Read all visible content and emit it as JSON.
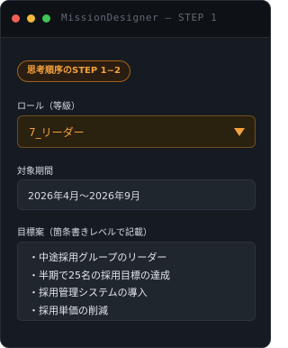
{
  "window": {
    "title": "MissionDesigner — STEP 1"
  },
  "badge": {
    "label": "思考順序のSTEP 1~2"
  },
  "role_field": {
    "label": "ロール（等級）",
    "selected": "7_リーダー"
  },
  "period_field": {
    "label": "対象期間",
    "value": "2026年4月〜2026年9月"
  },
  "goals_field": {
    "label": "目標案（箇条書きレベルで記載）",
    "items": [
      "・中途採用グループのリーダー",
      "・半期で25名の採用目標の達成",
      "・採用管理システムの導入",
      "・採用単価の削減"
    ]
  },
  "colors": {
    "background": "#161b22",
    "titlebar": "#0e1217",
    "accent": "#f3a13b",
    "close": "#ee5e57",
    "minimize": "#f2b93a",
    "maximize": "#3fc354"
  },
  "icons": {
    "dropdown": "chevron-down-icon"
  }
}
